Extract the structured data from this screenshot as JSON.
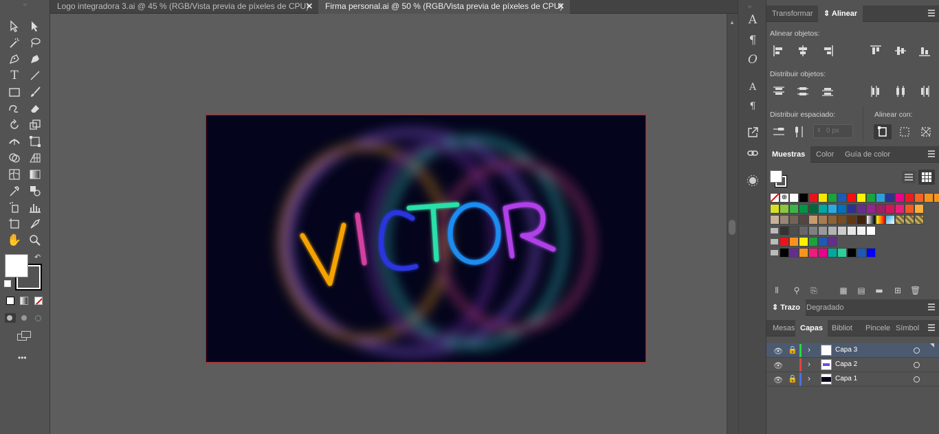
{
  "tabs": [
    {
      "label": "Logo integradora 3.ai @ 45 % (RGB/Vista previa de píxeles de CPU)",
      "close": "✕"
    },
    {
      "label": "Firma personal.ai @ 50 % (RGB/Vista previa de píxeles de CPU)",
      "close": "✕"
    }
  ],
  "artwork": {
    "text": "VICTOR",
    "letters": [
      "V",
      "I",
      "C",
      "T",
      "O",
      "R"
    ]
  },
  "colors": {
    "accent": "#d01818",
    "letter_colors": [
      "#f5a200",
      "#d43fa0",
      "#2a35e0",
      "#2ae0a8",
      "#1e8cf0",
      "#b040e8"
    ]
  },
  "toolbar": {
    "more": "•••"
  },
  "align_panel": {
    "tabs": [
      "Transformar",
      "Alinear"
    ],
    "align_objects": "Alinear objetos:",
    "distribute_objects": "Distribuir objetos:",
    "distribute_spacing": "Distribuir espaciado:",
    "spacing_value": "0 px",
    "align_to": "Alinear con:"
  },
  "swatches_panel": {
    "tabs": [
      "Muestras",
      "Color",
      "Guía de color"
    ]
  },
  "stroke_panel": {
    "tabs": [
      "Trazo",
      "Degradado"
    ]
  },
  "layers_panel": {
    "tabs": [
      "Mesas",
      "Capas",
      "Bibliot",
      "Pincele",
      "Símbol"
    ],
    "layers": [
      {
        "name": "Capa 3",
        "color": "#2ad83e",
        "locked": true,
        "selected": true
      },
      {
        "name": "Capa 2",
        "color": "#e04545",
        "locked": false,
        "selected": false
      },
      {
        "name": "Capa 1",
        "color": "#4f6fe0",
        "locked": true,
        "selected": false
      }
    ]
  }
}
